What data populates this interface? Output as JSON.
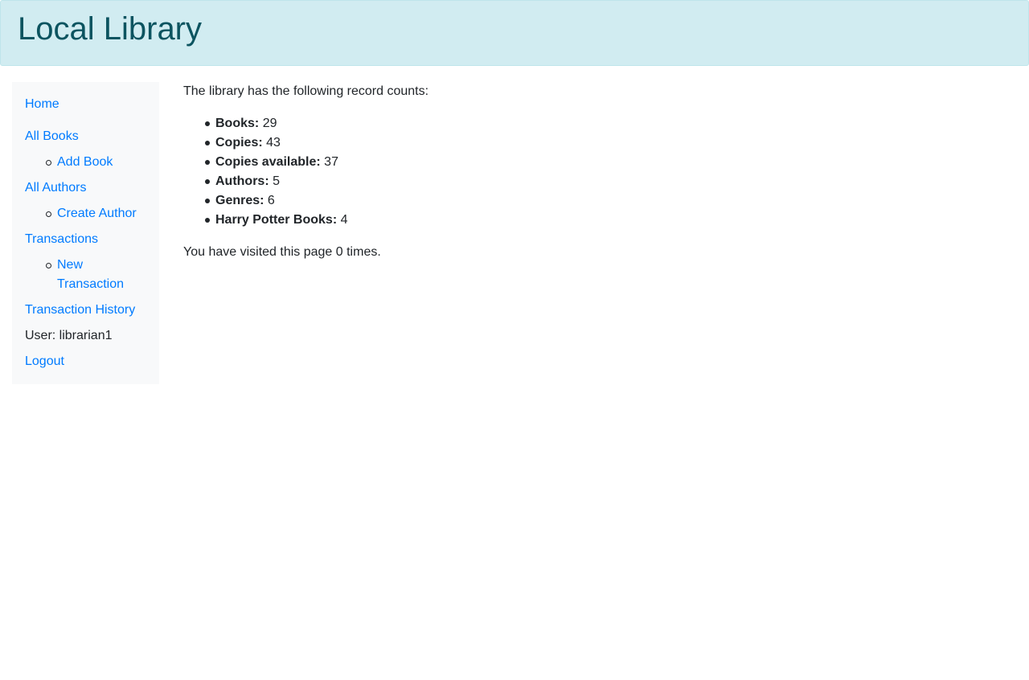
{
  "header": {
    "title": "Local Library"
  },
  "sidebar": {
    "home": "Home",
    "all_books": "All Books",
    "add_book": "Add Book",
    "all_authors": "All Authors",
    "create_author": "Create Author",
    "transactions": "Transactions",
    "new_transaction": "New Transaction",
    "transaction_history": "Transaction History",
    "user_label": "User: librarian1",
    "logout": "Logout"
  },
  "main": {
    "intro": "The library has the following record counts:",
    "counts": [
      {
        "label": "Books:",
        "value": "29"
      },
      {
        "label": "Copies:",
        "value": "43"
      },
      {
        "label": "Copies available:",
        "value": "37"
      },
      {
        "label": "Authors:",
        "value": "5"
      },
      {
        "label": "Genres:",
        "value": "6"
      },
      {
        "label": "Harry Potter Books:",
        "value": "4"
      }
    ],
    "visits": "You have visited this page 0 times."
  },
  "colors": {
    "header_bg": "#d1ecf1",
    "header_text": "#0c5460",
    "link": "#007bff",
    "sidebar_bg": "#f8f9fa"
  }
}
